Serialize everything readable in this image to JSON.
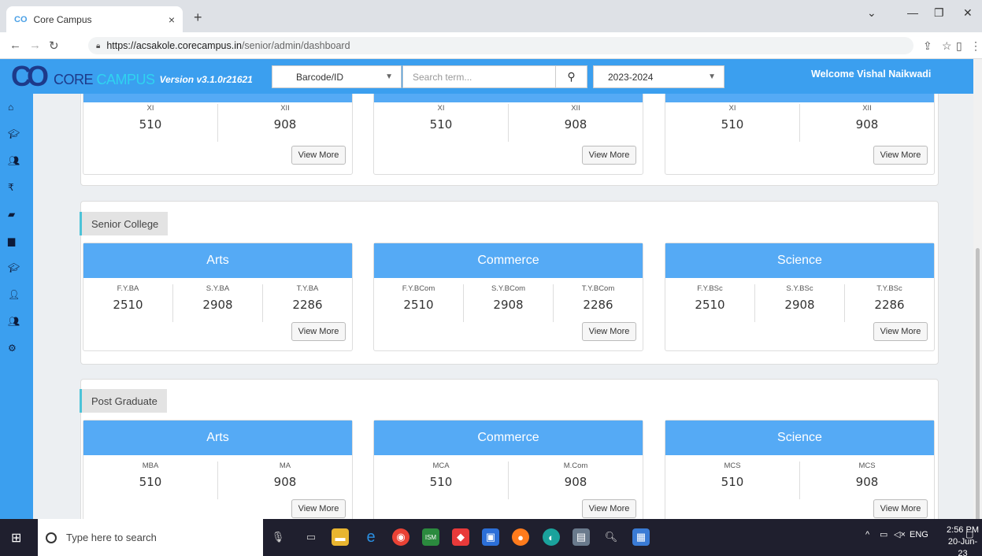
{
  "browser": {
    "tab_title": "Core Campus",
    "favicon": "CO",
    "new_tab": "+",
    "close_tab": "×",
    "url_host": "https://acsakole.corecampus.in",
    "url_path": "/senior/admin/dashboard"
  },
  "header": {
    "logo": "CO",
    "brand_core": "CORE",
    "brand_campus": "CAMPUS",
    "version": "Version v3.1.0r21621",
    "barcode_select": "Barcode/ID",
    "search_placeholder": "Search term...",
    "year_select": "2023-2024",
    "welcome": "Welcome Vishal Naikwadi"
  },
  "sidebar": {
    "items": [
      "home-icon",
      "graduation-icon",
      "users-icon",
      "rupee-icon",
      "book-icon",
      "file-icon",
      "graduation-icon",
      "user-icon",
      "users-icon",
      "cogs-icon"
    ]
  },
  "top_section": {
    "cards": [
      {
        "cells": [
          {
            "label": "XI",
            "value": "510"
          },
          {
            "label": "XII",
            "value": "908"
          }
        ],
        "button": "View More"
      },
      {
        "cells": [
          {
            "label": "XI",
            "value": "510"
          },
          {
            "label": "XII",
            "value": "908"
          }
        ],
        "button": "View More"
      },
      {
        "cells": [
          {
            "label": "XI",
            "value": "510"
          },
          {
            "label": "XII",
            "value": "908"
          }
        ],
        "button": "View More"
      }
    ]
  },
  "senior_college": {
    "label": "Senior College",
    "cards": [
      {
        "title": "Arts",
        "cells": [
          {
            "label": "F.Y.BA",
            "value": "2510"
          },
          {
            "label": "S.Y.BA",
            "value": "2908"
          },
          {
            "label": "T.Y.BA",
            "value": "2286"
          }
        ],
        "button": "View More"
      },
      {
        "title": "Commerce",
        "cells": [
          {
            "label": "F.Y.BCom",
            "value": "2510"
          },
          {
            "label": "S.Y.BCom",
            "value": "2908"
          },
          {
            "label": "T.Y.BCom",
            "value": "2286"
          }
        ],
        "button": "View More"
      },
      {
        "title": "Science",
        "cells": [
          {
            "label": "F.Y.BSc",
            "value": "2510"
          },
          {
            "label": "S.Y.BSc",
            "value": "2908"
          },
          {
            "label": "T.Y.BSc",
            "value": "2286"
          }
        ],
        "button": "View More"
      }
    ]
  },
  "post_graduate": {
    "label": "Post Graduate",
    "cards": [
      {
        "title": "Arts",
        "cells": [
          {
            "label": "MBA",
            "value": "510"
          },
          {
            "label": "MA",
            "value": "908"
          }
        ],
        "button": "View More"
      },
      {
        "title": "Commerce",
        "cells": [
          {
            "label": "MCA",
            "value": "510"
          },
          {
            "label": "M.Com",
            "value": "908"
          }
        ],
        "button": "View More"
      },
      {
        "title": "Science",
        "cells": [
          {
            "label": "MCS",
            "value": "510"
          },
          {
            "label": "MCS",
            "value": "908"
          }
        ],
        "button": "View More"
      }
    ]
  },
  "taskbar": {
    "search_placeholder": "Type here to search",
    "lang": "ENG",
    "time": "2:56 PM",
    "date": "20-Jun-23"
  },
  "colors": {
    "accent": "#3b9fef",
    "card_head": "#55aaf5"
  }
}
